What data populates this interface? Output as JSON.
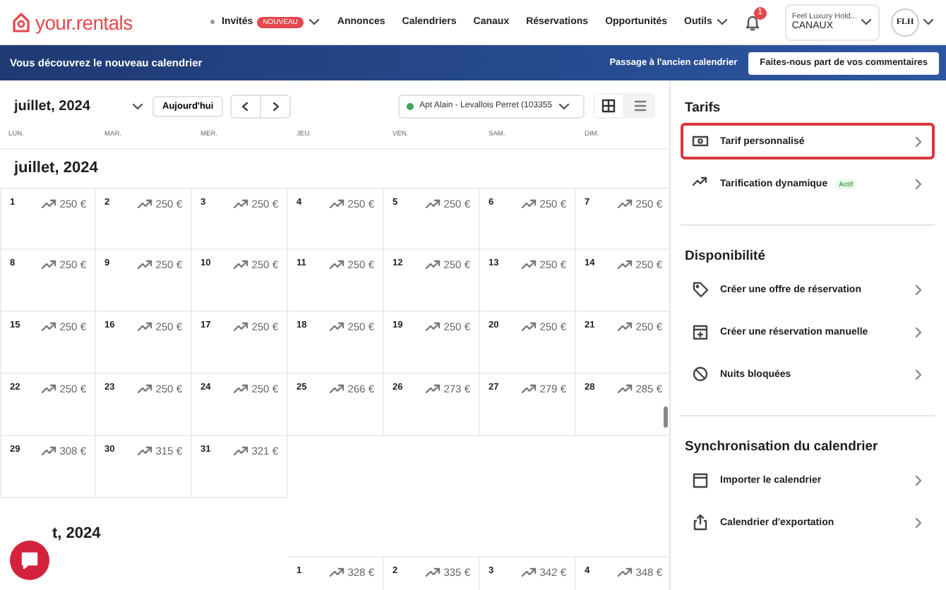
{
  "logo": "your.rentals",
  "nav": [
    {
      "kind": "dropdown",
      "label": "Invités",
      "badge": "NOUVEAU"
    },
    {
      "kind": "link",
      "label": "Annonces"
    },
    {
      "kind": "link",
      "label": "Calendriers"
    },
    {
      "kind": "link",
      "label": "Canaux"
    },
    {
      "kind": "link",
      "label": "Réservations"
    },
    {
      "kind": "link",
      "label": "Opportunités"
    },
    {
      "kind": "dropdown",
      "label": "Outils"
    }
  ],
  "notifications": {
    "count": "1"
  },
  "account": {
    "name": "Feel Luxury Hold...",
    "subtitle": "CANAUX"
  },
  "avatar": "FLH",
  "banner": {
    "message": "Vous découvrez le nouveau calendrier",
    "link": "Passage à l'ancien calendrier",
    "button": "Faites-nous part de vos commentaires"
  },
  "toolbar": {
    "month": "juillet, 2024",
    "today": "Aujourd'hui",
    "property": "Apt Alain - Levallois Perret (103355",
    "views": [
      {
        "kind": "grid",
        "selected": true
      },
      {
        "kind": "list",
        "selected": false
      }
    ]
  },
  "weekdays": [
    "LUN.",
    "MAR.",
    "MER.",
    "JEU.",
    "VEN.",
    "SAM.",
    "DIM."
  ],
  "months": [
    {
      "title": "juillet, 2024",
      "days": [
        {
          "kind": "day",
          "day": "1",
          "price": "250 €"
        },
        {
          "kind": "day",
          "day": "2",
          "price": "250 €"
        },
        {
          "kind": "day",
          "day": "3",
          "price": "250 €"
        },
        {
          "kind": "day",
          "day": "4",
          "price": "250 €"
        },
        {
          "kind": "day",
          "day": "5",
          "price": "250 €"
        },
        {
          "kind": "day",
          "day": "6",
          "price": "250 €"
        },
        {
          "kind": "day",
          "day": "7",
          "price": "250 €"
        },
        {
          "kind": "day",
          "day": "8",
          "price": "250 €"
        },
        {
          "kind": "day",
          "day": "9",
          "price": "250 €"
        },
        {
          "kind": "day",
          "day": "10",
          "price": "250 €"
        },
        {
          "kind": "day",
          "day": "11",
          "price": "250 €"
        },
        {
          "kind": "day",
          "day": "12",
          "price": "250 €"
        },
        {
          "kind": "day",
          "day": "13",
          "price": "250 €"
        },
        {
          "kind": "day",
          "day": "14",
          "price": "250 €"
        },
        {
          "kind": "day",
          "day": "15",
          "price": "250 €"
        },
        {
          "kind": "day",
          "day": "16",
          "price": "250 €"
        },
        {
          "kind": "day",
          "day": "17",
          "price": "250 €"
        },
        {
          "kind": "day",
          "day": "18",
          "price": "250 €"
        },
        {
          "kind": "day",
          "day": "19",
          "price": "250 €"
        },
        {
          "kind": "day",
          "day": "20",
          "price": "250 €"
        },
        {
          "kind": "day",
          "day": "21",
          "price": "250 €"
        },
        {
          "kind": "day",
          "day": "22",
          "price": "250 €"
        },
        {
          "kind": "day",
          "day": "23",
          "price": "250 €"
        },
        {
          "kind": "day",
          "day": "24",
          "price": "250 €"
        },
        {
          "kind": "day",
          "day": "25",
          "price": "266 €"
        },
        {
          "kind": "day",
          "day": "26",
          "price": "273 €"
        },
        {
          "kind": "day",
          "day": "27",
          "price": "279 €"
        },
        {
          "kind": "day",
          "day": "28",
          "price": "285 €"
        },
        {
          "kind": "day",
          "day": "29",
          "price": "308 €"
        },
        {
          "kind": "day",
          "day": "30",
          "price": "315 €"
        },
        {
          "kind": "day",
          "day": "31",
          "price": "321 €"
        }
      ]
    },
    {
      "title": "t, 2024",
      "days": [
        {
          "kind": "blank"
        },
        {
          "kind": "blank"
        },
        {
          "kind": "blank"
        },
        {
          "kind": "day",
          "day": "1",
          "price": "328 €"
        },
        {
          "kind": "day",
          "day": "2",
          "price": "335 €"
        },
        {
          "kind": "day",
          "day": "3",
          "price": "342 €"
        },
        {
          "kind": "day",
          "day": "4",
          "price": "348 €"
        }
      ]
    }
  ],
  "panel": [
    {
      "title": "Tarifs",
      "items": [
        {
          "kind": "money",
          "label": "Tarif personnalisé",
          "selected": true
        },
        {
          "kind": "trend",
          "label": "Tarification dynamique",
          "badge": "Actif",
          "selected": false
        }
      ]
    },
    {
      "title": "Disponibilité",
      "items": [
        {
          "kind": "tag",
          "label": "Créer une offre de réservation",
          "selected": false
        },
        {
          "kind": "booking",
          "label": "Créer une réservation manuelle",
          "selected": false
        },
        {
          "kind": "blocked",
          "label": "Nuits bloquées",
          "selected": false
        }
      ]
    },
    {
      "title": "Synchronisation du calendrier",
      "items": [
        {
          "kind": "import",
          "label": "Importer le calendrier",
          "selected": false
        },
        {
          "kind": "export",
          "label": "Calendrier d'exportation",
          "selected": false
        }
      ]
    }
  ]
}
